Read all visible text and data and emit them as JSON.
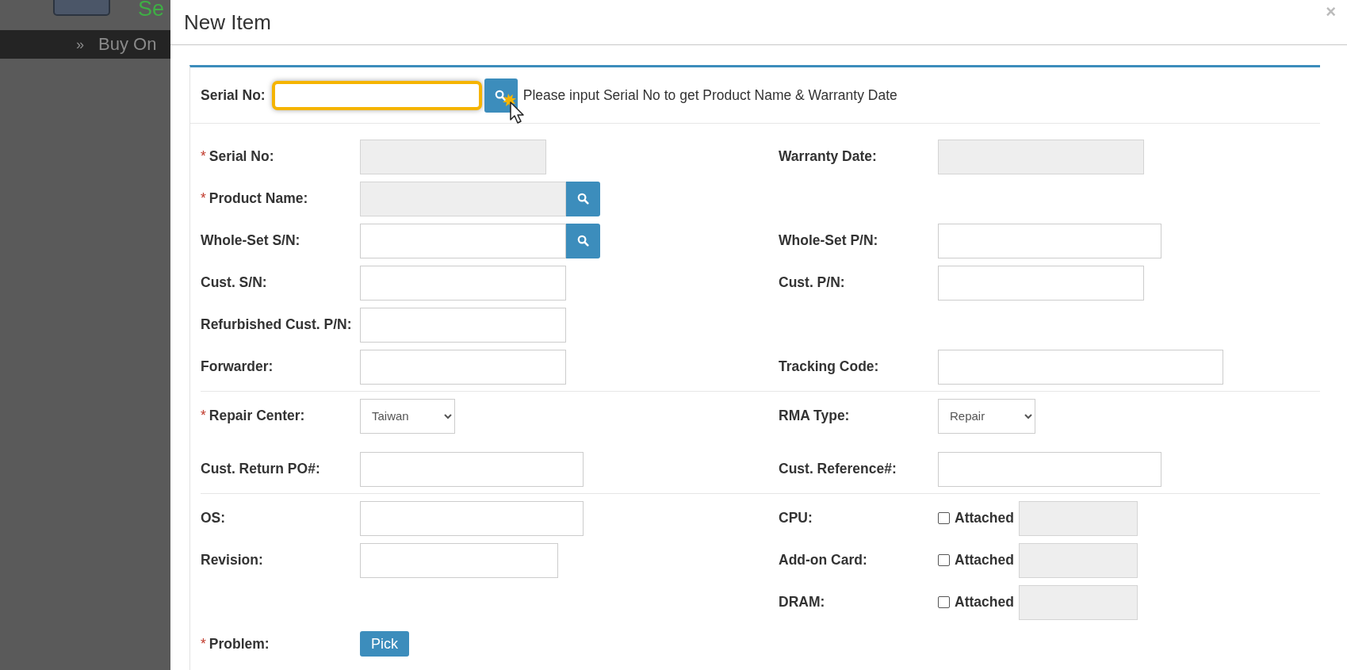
{
  "background": {
    "brand_text": "Se",
    "nav_marker": "»",
    "nav_text": "Buy On"
  },
  "dialog": {
    "title": "New Item",
    "close": "×"
  },
  "lookup": {
    "label": "Serial No:",
    "hint": "Please input Serial No to get Product Name & Warranty Date",
    "highlighted": true
  },
  "sections": [
    [
      {
        "left": {
          "marker": "*",
          "label": "Serial No:",
          "field": {
            "kind": "readonly"
          }
        },
        "right": {
          "label": "Warranty Date:",
          "field": {
            "kind": "readonly"
          }
        }
      },
      {
        "left": {
          "marker": "*",
          "label": "Product Name:",
          "field": {
            "kind": "readonly_search"
          }
        }
      },
      {
        "left": {
          "label": "Whole-Set S/N:",
          "field": {
            "kind": "search"
          }
        },
        "right": {
          "label": "Whole-Set P/N:",
          "field": {
            "kind": "text"
          }
        }
      },
      {
        "left": {
          "label": "Cust. S/N:",
          "field": {
            "kind": "text"
          }
        },
        "right": {
          "label": "Cust. P/N:",
          "field": {
            "kind": "text"
          }
        }
      },
      {
        "left": {
          "label": "Refurbished Cust. P/N:",
          "field": {
            "kind": "text"
          }
        }
      },
      {
        "left": {
          "label": "Forwarder:",
          "field": {
            "kind": "text"
          }
        },
        "right": {
          "label": "Tracking Code:",
          "field": {
            "kind": "text"
          }
        }
      }
    ],
    [
      {
        "left": {
          "marker": "*",
          "label": "Repair Center:",
          "field": {
            "kind": "select",
            "value": "Taiwan"
          }
        },
        "right": {
          "label": "RMA Type:",
          "field": {
            "kind": "select",
            "value": "Repair"
          }
        }
      },
      {
        "left": {
          "label": "Cust. Return PO#:",
          "field": {
            "kind": "text"
          }
        },
        "right": {
          "label": "Cust. Reference#:",
          "field": {
            "kind": "text"
          }
        }
      }
    ],
    [
      {
        "left": {
          "label": "OS:",
          "field": {
            "kind": "text"
          }
        },
        "right": {
          "label": "CPU:",
          "field": {
            "kind": "attached",
            "label": "Attached",
            "checked": false
          }
        }
      },
      {
        "left": {
          "label": "Revision:",
          "field": {
            "kind": "text"
          }
        },
        "right": {
          "label": "Add-on Card:",
          "field": {
            "kind": "attached",
            "label": "Attached",
            "checked": false
          }
        }
      },
      {
        "right": {
          "label": "DRAM:",
          "field": {
            "kind": "attached",
            "label": "Attached",
            "checked": false
          }
        }
      }
    ]
  ],
  "problem": {
    "marker": "*",
    "label": "Problem:",
    "button": "Pick"
  }
}
